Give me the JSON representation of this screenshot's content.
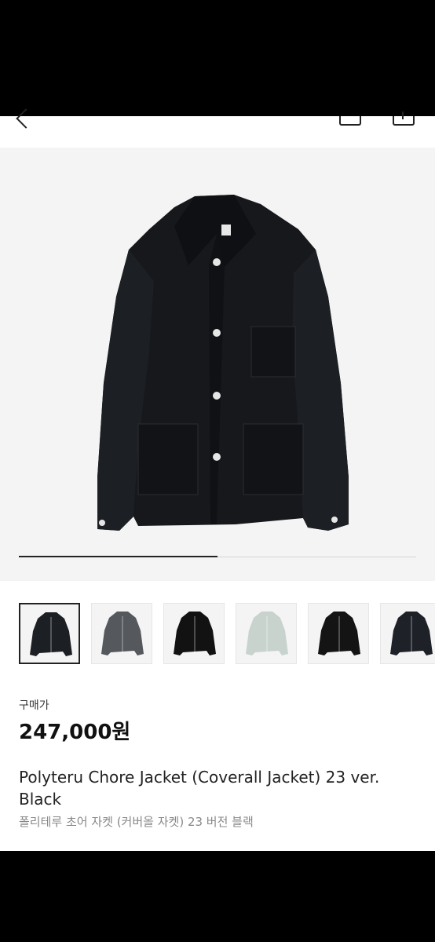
{
  "carousel": {
    "progress": 0.5
  },
  "thumbnails": [
    {
      "selected": true,
      "color": "#1c1f24"
    },
    {
      "selected": false,
      "color": "#55585c"
    },
    {
      "selected": false,
      "color": "#121212"
    },
    {
      "selected": false,
      "color": "#c9d3ce"
    },
    {
      "selected": false,
      "color": "#141414"
    },
    {
      "selected": false,
      "color": "#1e2128"
    }
  ],
  "product": {
    "price_label": "구매가",
    "price": "247,000원",
    "title_en": "Polyteru Chore Jacket (Coverall Jacket) 23 ver. Black",
    "title_ko": "폴리테루 초어 자켓 (커버올 자켓) 23 버전 블랙"
  },
  "icons": {
    "back": "back-icon",
    "bag": "shopping-bag-icon",
    "share": "share-icon"
  }
}
